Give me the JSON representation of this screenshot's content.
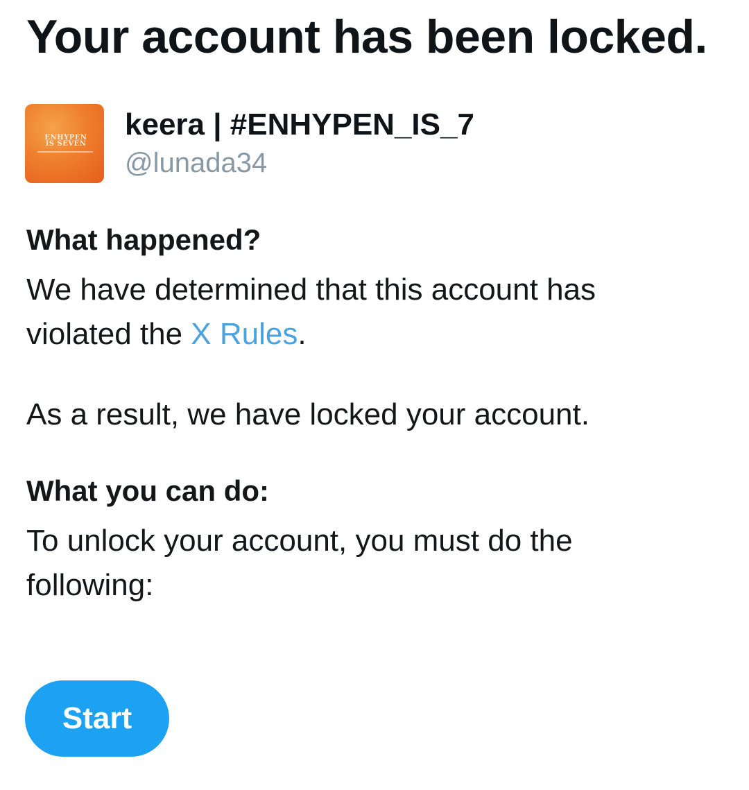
{
  "title": "Your account has been locked.",
  "account": {
    "display_name": "keera | #ENHYPEN_IS_7",
    "handle": "@lunada34",
    "avatar_text_line1": "ENHYPEN",
    "avatar_text_line2": "IS SEVEN"
  },
  "what_happened": {
    "heading": "What happened?",
    "text_before_link": "We have determined that this account has violated the ",
    "link_label": "X Rules",
    "text_after_link": ".",
    "result_text": "As a result, we have locked your account."
  },
  "what_you_can_do": {
    "heading": "What you can do:",
    "text": "To unlock your account, you must do the following:"
  },
  "actions": {
    "start_label": "Start"
  },
  "colors": {
    "accent": "#1da1f2",
    "link": "#4aa3df",
    "handle": "#8899a6",
    "avatar": "#ef7f2c"
  }
}
